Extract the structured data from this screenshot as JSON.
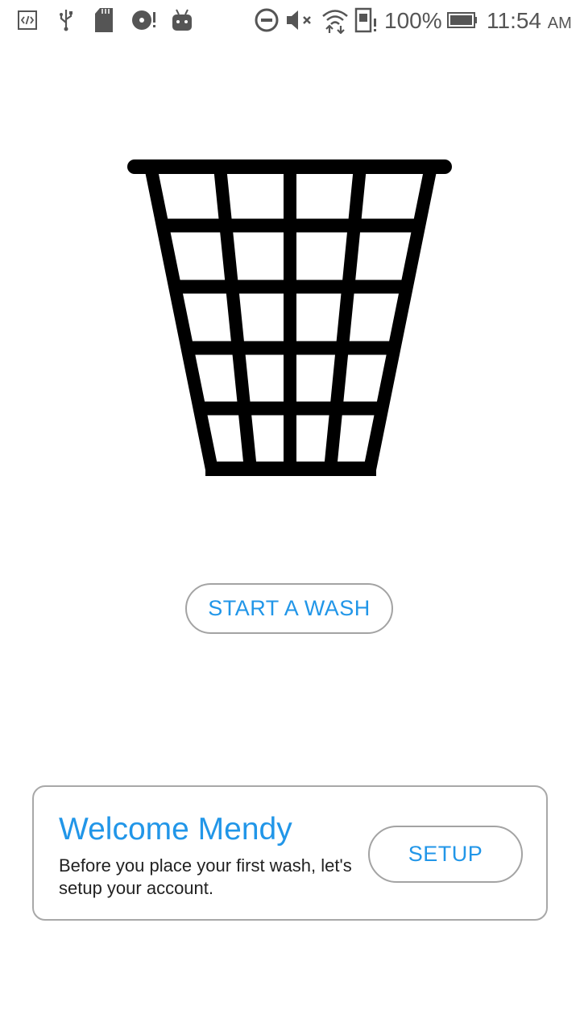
{
  "status_bar": {
    "battery_level": "100%",
    "time": "11:54",
    "ampm": "AM",
    "icon_color": "#555555",
    "left_icons": [
      "developer-mode-icon",
      "usb-icon",
      "sd-card-icon",
      "disk-alert-icon",
      "android-debug-icon"
    ],
    "right_icons": [
      "do-not-disturb-icon",
      "mute-icon",
      "wifi-icon",
      "sim-alert-icon",
      "battery-icon"
    ]
  },
  "hero": {
    "icon": "laundry-basket-icon",
    "icon_color": "#000000"
  },
  "actions": {
    "start_wash_label": "START A WASH"
  },
  "welcome_card": {
    "title": "Welcome Mendy",
    "body": "Before you place your first wash, let's setup your account.",
    "setup_label": "SETUP"
  },
  "theme": {
    "accent": "#2196E8",
    "border": "#A8A8A8",
    "background": "#FFFFFF"
  }
}
